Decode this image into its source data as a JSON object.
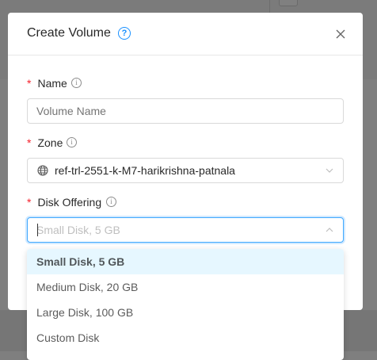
{
  "modal": {
    "title": "Create Volume",
    "help_icon": "question-circle-icon",
    "close_icon": "close-icon"
  },
  "form": {
    "name": {
      "required_mark": "*",
      "label": "Name",
      "placeholder": "Volume Name",
      "value": ""
    },
    "zone": {
      "required_mark": "*",
      "label": "Zone",
      "value": "ref-trl-2551-k-M7-harikrishna-patnala",
      "icon": "globe-icon"
    },
    "disk_offering": {
      "required_mark": "*",
      "label": "Disk Offering",
      "placeholder": "Small Disk, 5 GB",
      "options": [
        "Small Disk, 5 GB",
        "Medium Disk, 20 GB",
        "Large Disk, 100 GB",
        "Custom Disk"
      ],
      "highlighted_option": "Small Disk, 5 GB"
    }
  },
  "colors": {
    "accent": "#1890ff",
    "required": "#f5222d",
    "option_highlight": "#e6f7ff"
  }
}
